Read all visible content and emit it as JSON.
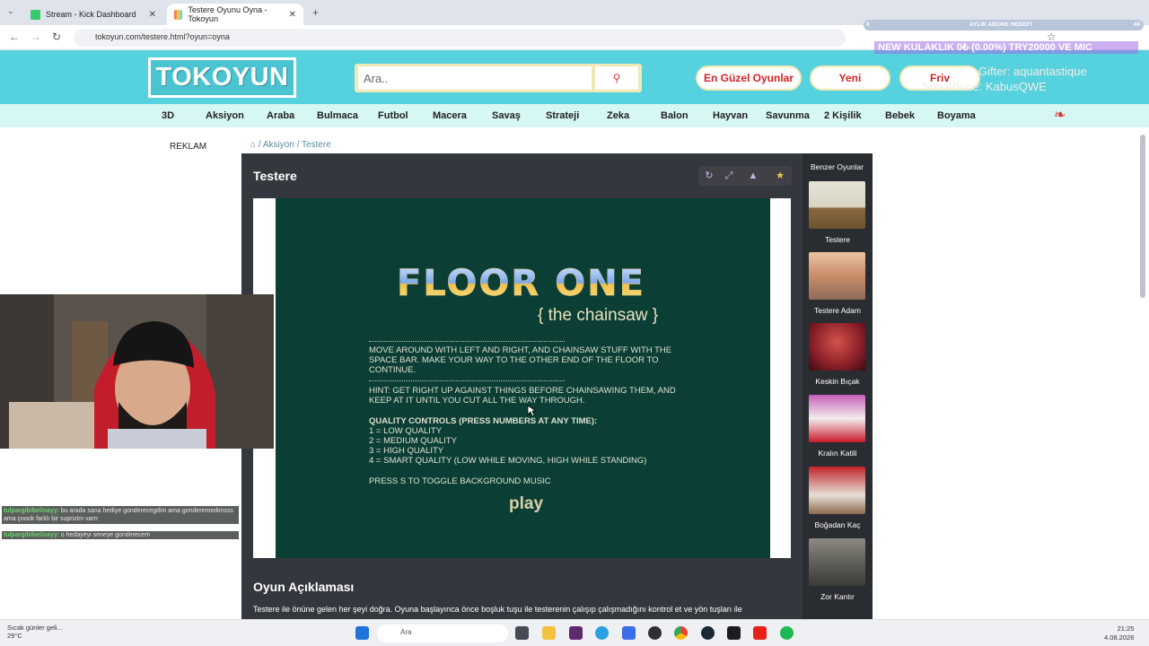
{
  "browser": {
    "tabs": [
      {
        "label": "Stream - Kick Dashboard",
        "active": false
      },
      {
        "label": "Testere Oyunu Oyna - Tokoyun",
        "active": true
      }
    ],
    "url": "tokoyun.com/testere.html?oyun=oyna"
  },
  "header": {
    "logo": "TOKOYUN",
    "search_placeholder": "Ara..",
    "buttons": [
      "En Güzel Oyunlar",
      "Yeni",
      "Friv"
    ]
  },
  "categories": [
    "3D",
    "Aksiyon",
    "Araba",
    "Bulmaca",
    "Futbol",
    "Macera",
    "Savaş",
    "Strateji",
    "Zeka",
    "Balon",
    "Hayvan",
    "Savunma",
    "2 Kişilik",
    "Bebek",
    "Boyama"
  ],
  "ad_label": "REKLAM",
  "breadcrumb": [
    "Aksiyon",
    "Testere"
  ],
  "game": {
    "title": "Testere",
    "screen": {
      "title": "FLOOR ONE",
      "subtitle": "{ the chainsaw }",
      "instructions": "MOVE AROUND WITH LEFT AND RIGHT, AND CHAINSAW STUFF WITH THE SPACE BAR. MAKE YOUR WAY TO THE OTHER END OF THE FLOOR TO CONTINUE.",
      "hint": "HINT: GET RIGHT UP AGAINST THINGS BEFORE CHAINSAWING THEM, AND KEEP AT IT UNTIL YOU CUT ALL THE WAY THROUGH.",
      "quality_header": "QUALITY CONTROLS (PRESS NUMBERS AT ANY TIME):",
      "quality_options": [
        "1 = LOW QUALITY",
        "2 = MEDIUM QUALITY",
        "3 = HIGH QUALITY",
        "4 = SMART QUALITY (LOW WHILE MOVING, HIGH WHILE STANDING)"
      ],
      "music": "PRESS S TO TOGGLE BACKGROUND MUSIC",
      "play": "play"
    }
  },
  "description": {
    "title": "Oyun Açıklaması",
    "text": "Testere ile önüne gelen her şeyi doğra. Oyuna başlayınca önce boşluk tuşu ile testerenin çalışıp çalışmadığını kontrol et ve yön tuşları ile"
  },
  "similar": {
    "title": "Benzer Oyunlar",
    "games": [
      "Testere",
      "Testere Adam",
      "Keskin Bıçak",
      "Kralın Katili",
      "Boğadan Kaç",
      "Zor Kantır"
    ]
  },
  "overlay": {
    "goal_label": "AYLIK ABONE HEDEFİ",
    "goal_start": "0",
    "goal_end": "40",
    "goal_text": "NEW KULAKLIK  0₺ (0.00%)  TRY20000 VE MIC",
    "gifter": "Gifter: aquantastique",
    "subscriber": "Son Abone: KabusQWE",
    "chat": [
      {
        "user": "tulpargibibelinayy",
        "message": ": bu arada sana hediye gonderecegdim ama gonderemedimsss ama çoook farklı bir suprizim varrr"
      },
      {
        "user": "tulpargibibelinayy",
        "message": ": o hedayeyi seneye gonderecem"
      }
    ]
  },
  "taskbar": {
    "weather": "Sıcak günler geli...",
    "temp": "29°C",
    "search": "Ara",
    "time": "21:25",
    "date": "4.08.2026"
  },
  "colors": {
    "header_bg": "#56d1de",
    "category_bg": "#d6f7f4",
    "game_bg": "#0b3f36",
    "accent_red": "#d22424"
  }
}
